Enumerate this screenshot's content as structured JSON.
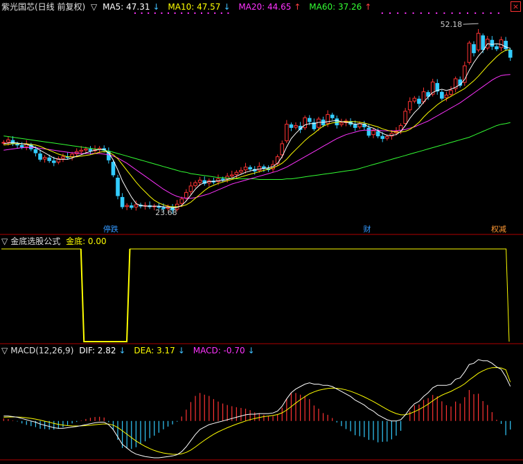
{
  "header": {
    "title": "紫光国芯(日线 前复权)",
    "ma5_label": "MA5: 47.31",
    "ma10_label": "MA10: 47.57",
    "ma20_label": "MA20: 44.65",
    "ma60_label": "MA60: 37.26",
    "ma5_arrow": "↓",
    "ma10_arrow": "↓",
    "ma20_arrow": "↑",
    "ma60_arrow": "↑"
  },
  "indicator": {
    "name": "金底选股公式",
    "value_label": "金底: 0.00"
  },
  "macd": {
    "name": "MACD(12,26,9)",
    "dif_label": "DIF: 2.82",
    "dif_arrow": "↓",
    "dea_label": "DEA: 3.17",
    "dea_arrow": "↓",
    "macd_label": "MACD: -0.70",
    "macd_arrow": "↓"
  },
  "icons": {
    "triangle": "▽",
    "close": "×"
  },
  "colors": {
    "up": "#ff3333",
    "down": "#33ccff",
    "ma5": "#ffffff",
    "ma10": "#ffff00",
    "ma20": "#ff33ff",
    "ma60": "#33ff33",
    "border": "#b00000"
  },
  "chart_data": [
    {
      "type": "candlestick",
      "ylim": [
        21,
        54
      ],
      "annotations": {
        "high": "52.18",
        "low": "23.68"
      },
      "event_labels": [
        "停跌",
        "财",
        "权减"
      ],
      "close": [
        34.2,
        34.6,
        34.0,
        33.8,
        33.5,
        33.9,
        33.2,
        32.6,
        31.6,
        31.9,
        31.4,
        31.1,
        31.7,
        32.0,
        31.9,
        32.4,
        32.8,
        33.0,
        33.2,
        32.9,
        33.1,
        33.3,
        33.0,
        31.5,
        29.2,
        26.0,
        24.3,
        24.5,
        24.2,
        24.6,
        24.4,
        24.5,
        24.3,
        24.4,
        24.2,
        24.0,
        24.3,
        23.8,
        24.7,
        25.5,
        26.5,
        27.5,
        28.0,
        28.4,
        27.9,
        28.3,
        28.1,
        28.6,
        28.5,
        29.0,
        29.2,
        29.6,
        29.9,
        30.4,
        30.1,
        29.8,
        30.5,
        30.2,
        30.0,
        30.8,
        32.0,
        34.0,
        37.0,
        36.5,
        36.8,
        36.2,
        38.0,
        37.4,
        36.3,
        37.8,
        36.9,
        38.5,
        38.0,
        36.9,
        37.2,
        37.5,
        37.0,
        36.5,
        37.1,
        36.6,
        35.3,
        36.0,
        35.2,
        34.8,
        35.1,
        35.6,
        35.9,
        36.8,
        39.0,
        40.5,
        41.0,
        40.2,
        42.0,
        41.3,
        43.5,
        42.1,
        41.0,
        41.5,
        42.2,
        44.0,
        43.0,
        46.0,
        49.5,
        48.0,
        51.0,
        48.5,
        50.1,
        49.0,
        48.6,
        50.0,
        48.6,
        47.3
      ],
      "ma5": [
        34.0,
        34.1,
        34.2,
        34.1,
        34.0,
        33.9,
        33.7,
        33.4,
        33.0,
        32.6,
        32.2,
        31.8,
        31.6,
        31.6,
        31.6,
        31.8,
        32.1,
        32.3,
        32.6,
        32.8,
        33.0,
        33.1,
        33.1,
        32.6,
        31.5,
        30.0,
        28.3,
        27.0,
        25.8,
        24.8,
        24.5,
        24.4,
        24.4,
        24.4,
        24.4,
        24.3,
        24.2,
        24.1,
        24.2,
        24.5,
        25.2,
        26.1,
        27.0,
        27.7,
        28.0,
        28.2,
        28.2,
        28.3,
        28.3,
        28.5,
        28.7,
        29.0,
        29.3,
        29.6,
        29.8,
        30.0,
        30.1,
        30.2,
        30.3,
        30.5,
        31.0,
        32.0,
        33.5,
        34.8,
        35.6,
        36.3,
        36.9,
        37.1,
        37.1,
        37.3,
        37.3,
        37.4,
        37.5,
        37.6,
        37.4,
        37.3,
        37.2,
        37.0,
        37.1,
        37.0,
        36.6,
        36.4,
        36.0,
        35.6,
        35.3,
        35.3,
        35.4,
        35.9,
        36.8,
        37.9,
        38.8,
        39.5,
        40.4,
        41.2,
        41.9,
        42.2,
        42.4,
        42.2,
        42.4,
        42.7,
        43.1,
        43.9,
        45.3,
        46.5,
        47.5,
        48.3,
        49.4,
        49.3,
        49.4,
        49.3,
        48.9,
        48.7
      ],
      "ma10": [
        33.8,
        33.9,
        34.0,
        34.0,
        34.0,
        34.0,
        33.9,
        33.8,
        33.6,
        33.3,
        33.0,
        32.7,
        32.4,
        32.2,
        32.0,
        32.0,
        32.0,
        32.1,
        32.2,
        32.3,
        32.5,
        32.7,
        32.8,
        32.7,
        32.3,
        31.7,
        30.8,
        29.9,
        29.0,
        28.1,
        27.3,
        26.6,
        25.9,
        25.3,
        24.9,
        24.6,
        24.4,
        24.3,
        24.3,
        24.4,
        24.6,
        25.0,
        25.6,
        26.2,
        26.8,
        27.3,
        27.6,
        27.9,
        28.1,
        28.3,
        28.5,
        28.7,
        28.9,
        29.1,
        29.3,
        29.5,
        29.7,
        29.9,
        30.1,
        30.3,
        30.6,
        31.0,
        31.6,
        32.4,
        33.1,
        33.8,
        34.5,
        35.1,
        35.6,
        36.2,
        36.7,
        37.0,
        37.2,
        37.3,
        37.4,
        37.4,
        37.4,
        37.4,
        37.3,
        37.2,
        37.0,
        36.8,
        36.6,
        36.3,
        36.1,
        35.9,
        35.8,
        35.8,
        35.9,
        36.2,
        36.7,
        37.3,
        38.1,
        38.8,
        39.4,
        40.0,
        40.5,
        40.9,
        41.3,
        41.7,
        42.1,
        42.5,
        43.1,
        43.7,
        44.4,
        45.2,
        46.0,
        46.7,
        47.4,
        48.0,
        48.4,
        48.5
      ],
      "ma20": [
        33.0,
        33.1,
        33.2,
        33.3,
        33.4,
        33.4,
        33.4,
        33.4,
        33.3,
        33.2,
        33.1,
        33.0,
        32.9,
        32.8,
        32.7,
        32.6,
        32.6,
        32.5,
        32.5,
        32.5,
        32.5,
        32.5,
        32.4,
        32.3,
        32.1,
        31.8,
        31.4,
        31.0,
        30.5,
        30.0,
        29.5,
        29.0,
        28.5,
        28.0,
        27.5,
        27.0,
        26.6,
        26.2,
        25.9,
        25.7,
        25.6,
        25.6,
        25.7,
        25.9,
        26.1,
        26.3,
        26.6,
        26.9,
        27.2,
        27.5,
        27.8,
        28.0,
        28.2,
        28.4,
        28.6,
        28.8,
        29.0,
        29.2,
        29.4,
        29.6,
        29.8,
        30.1,
        30.4,
        30.8,
        31.2,
        31.6,
        32.0,
        32.4,
        32.8,
        33.2,
        33.6,
        34.0,
        34.4,
        34.8,
        35.1,
        35.4,
        35.6,
        35.8,
        36.0,
        36.1,
        36.1,
        36.1,
        36.1,
        36.0,
        36.0,
        36.0,
        36.0,
        36.1,
        36.2,
        36.4,
        36.6,
        36.9,
        37.2,
        37.5,
        37.9,
        38.3,
        38.7,
        39.1,
        39.5,
        39.9,
        40.3,
        40.8,
        41.3,
        41.8,
        42.3,
        42.8,
        43.3,
        43.8,
        44.2,
        44.5,
        44.6,
        44.65
      ],
      "ma60": [
        35.2,
        35.1,
        35.0,
        34.9,
        34.8,
        34.7,
        34.6,
        34.5,
        34.4,
        34.3,
        34.2,
        34.1,
        34.0,
        33.9,
        33.8,
        33.7,
        33.6,
        33.5,
        33.4,
        33.3,
        33.2,
        33.1,
        33.0,
        32.9,
        32.7,
        32.5,
        32.3,
        32.1,
        31.9,
        31.7,
        31.5,
        31.3,
        31.1,
        30.9,
        30.7,
        30.5,
        30.3,
        30.1,
        29.9,
        29.7,
        29.6,
        29.4,
        29.3,
        29.2,
        29.1,
        29.0,
        28.9,
        28.8,
        28.8,
        28.7,
        28.7,
        28.6,
        28.6,
        28.6,
        28.6,
        28.6,
        28.5,
        28.5,
        28.5,
        28.5,
        28.5,
        28.5,
        28.6,
        28.6,
        28.7,
        28.8,
        28.9,
        29.0,
        29.1,
        29.2,
        29.3,
        29.4,
        29.5,
        29.6,
        29.7,
        29.8,
        29.9,
        30.0,
        30.2,
        30.4,
        30.6,
        30.8,
        31.0,
        31.2,
        31.4,
        31.6,
        31.8,
        32.0,
        32.2,
        32.4,
        32.6,
        32.8,
        33.0,
        33.2,
        33.4,
        33.6,
        33.8,
        34.0,
        34.2,
        34.4,
        34.6,
        34.8,
        35.0,
        35.3,
        35.6,
        35.9,
        36.2,
        36.5,
        36.8,
        37.0,
        37.1,
        37.26
      ]
    },
    {
      "type": "line",
      "series": [
        {
          "name": "金底",
          "values": [
            1,
            1,
            1,
            1,
            1,
            1,
            1,
            1,
            1,
            1,
            1,
            1,
            1,
            1,
            1,
            1,
            1,
            1,
            1,
            1,
            1,
            1,
            1,
            1,
            1,
            1,
            1,
            0,
            0,
            0,
            0,
            0,
            0,
            0,
            0,
            0,
            0,
            0,
            0,
            0,
            0,
            0,
            1,
            1,
            1,
            1,
            1,
            1,
            1,
            1,
            1,
            1,
            1,
            1,
            1,
            1,
            1,
            1,
            1,
            1,
            1,
            1,
            1,
            1,
            1,
            1,
            1,
            1,
            1,
            1,
            1,
            1,
            1,
            1,
            1,
            1,
            1,
            1,
            1,
            1,
            1,
            1,
            1,
            1,
            1,
            1,
            1,
            1,
            1,
            1,
            1,
            1,
            1,
            1,
            1,
            1,
            1,
            1,
            1,
            1,
            1,
            1,
            1,
            1,
            1,
            1,
            1,
            1,
            1,
            1,
            1,
            1,
            1,
            1,
            1,
            1,
            1,
            1,
            1,
            1,
            1,
            1,
            1,
            1,
            1,
            1,
            1,
            1,
            1,
            1,
            1,
            1,
            1,
            1,
            1,
            1,
            1,
            1,
            1,
            1,
            1,
            1,
            1,
            1,
            1,
            1,
            1,
            1,
            1,
            1,
            1,
            1,
            1,
            1,
            1,
            1,
            1,
            1,
            1,
            1,
            1,
            1,
            1,
            1,
            1,
            1,
            0
          ]
        }
      ],
      "ylim": [
        0,
        1
      ]
    },
    {
      "type": "bar",
      "ylim": [
        -3,
        5
      ],
      "dif": [
        0.4,
        0.4,
        0.35,
        0.3,
        0.2,
        0.1,
        0.0,
        -0.1,
        -0.25,
        -0.35,
        -0.45,
        -0.55,
        -0.6,
        -0.6,
        -0.55,
        -0.5,
        -0.45,
        -0.38,
        -0.3,
        -0.22,
        -0.15,
        -0.1,
        -0.1,
        -0.3,
        -0.7,
        -1.3,
        -1.9,
        -2.2,
        -2.5,
        -2.7,
        -2.8,
        -2.9,
        -2.95,
        -3.0,
        -3.0,
        -2.95,
        -2.9,
        -2.85,
        -2.75,
        -2.5,
        -2.1,
        -1.6,
        -1.1,
        -0.7,
        -0.5,
        -0.3,
        -0.2,
        -0.1,
        0.0,
        0.1,
        0.2,
        0.3,
        0.4,
        0.5,
        0.55,
        0.55,
        0.6,
        0.6,
        0.6,
        0.65,
        0.8,
        1.2,
        1.8,
        2.3,
        2.6,
        2.8,
        3.0,
        3.1,
        3.0,
        3.0,
        2.9,
        2.9,
        2.8,
        2.6,
        2.4,
        2.2,
        2.0,
        1.7,
        1.5,
        1.3,
        1.0,
        0.8,
        0.5,
        0.3,
        0.1,
        0.0,
        0.0,
        0.1,
        0.5,
        1.0,
        1.4,
        1.6,
        2.0,
        2.3,
        2.7,
        2.9,
        2.9,
        2.9,
        3.0,
        3.4,
        3.5,
        4.0,
        4.6,
        4.7,
        5.0,
        4.9,
        4.9,
        4.7,
        4.4,
        4.2,
        3.6,
        2.82
      ],
      "dea": [
        0.3,
        0.32,
        0.33,
        0.32,
        0.3,
        0.26,
        0.21,
        0.15,
        0.07,
        -0.02,
        -0.1,
        -0.2,
        -0.28,
        -0.34,
        -0.38,
        -0.4,
        -0.41,
        -0.4,
        -0.38,
        -0.35,
        -0.31,
        -0.27,
        -0.24,
        -0.25,
        -0.34,
        -0.53,
        -0.8,
        -1.08,
        -1.36,
        -1.63,
        -1.86,
        -2.07,
        -2.25,
        -2.4,
        -2.52,
        -2.61,
        -2.67,
        -2.71,
        -2.72,
        -2.68,
        -2.56,
        -2.37,
        -2.12,
        -1.84,
        -1.57,
        -1.32,
        -1.09,
        -0.89,
        -0.71,
        -0.55,
        -0.4,
        -0.26,
        -0.13,
        0.0,
        0.11,
        0.2,
        0.28,
        0.35,
        0.4,
        0.45,
        0.52,
        0.66,
        0.89,
        1.17,
        1.46,
        1.73,
        1.98,
        2.21,
        2.37,
        2.5,
        2.58,
        2.65,
        2.68,
        2.66,
        2.61,
        2.53,
        2.42,
        2.28,
        2.12,
        1.96,
        1.77,
        1.58,
        1.37,
        1.15,
        0.94,
        0.75,
        0.6,
        0.5,
        0.5,
        0.6,
        0.76,
        0.93,
        1.14,
        1.37,
        1.64,
        1.89,
        2.1,
        2.26,
        2.41,
        2.61,
        2.79,
        3.03,
        3.34,
        3.61,
        3.89,
        4.09,
        4.25,
        4.34,
        4.35,
        4.32,
        4.18,
        3.17
      ],
      "histogram_values": [
        0.2,
        0.16,
        0.04,
        -0.04,
        -0.2,
        -0.32,
        -0.42,
        -0.5,
        -0.64,
        -0.66,
        -0.7,
        -0.7,
        -0.64,
        -0.52,
        -0.34,
        -0.2,
        -0.08,
        0.04,
        0.16,
        0.26,
        0.32,
        0.34,
        0.28,
        -0.1,
        -0.72,
        -1.54,
        -2.2,
        -2.24,
        -2.28,
        -2.14,
        -1.88,
        -1.66,
        -1.4,
        -1.2,
        -0.96,
        -0.68,
        -0.46,
        -0.28,
        -0.06,
        0.36,
        0.92,
        1.54,
        2.04,
        2.28,
        2.14,
        2.04,
        1.78,
        1.58,
        1.42,
        1.3,
        1.2,
        1.12,
        1.06,
        1.0,
        0.88,
        0.7,
        0.64,
        0.5,
        0.4,
        0.4,
        0.56,
        1.08,
        1.82,
        2.26,
        2.28,
        2.14,
        2.04,
        1.78,
        1.26,
        1.0,
        0.64,
        0.5,
        0.24,
        -0.12,
        -0.42,
        -0.66,
        -0.84,
        -1.16,
        -1.24,
        -1.32,
        -1.54,
        -1.56,
        -1.74,
        -1.7,
        -1.68,
        -1.5,
        -1.2,
        -0.8,
        0.0,
        0.8,
        1.28,
        1.34,
        1.72,
        1.86,
        2.12,
        2.02,
        1.6,
        1.28,
        1.18,
        1.58,
        1.42,
        1.94,
        2.52,
        2.18,
        2.22,
        1.62,
        1.3,
        0.72,
        0.1,
        -0.24,
        -1.16,
        -0.7
      ]
    }
  ]
}
